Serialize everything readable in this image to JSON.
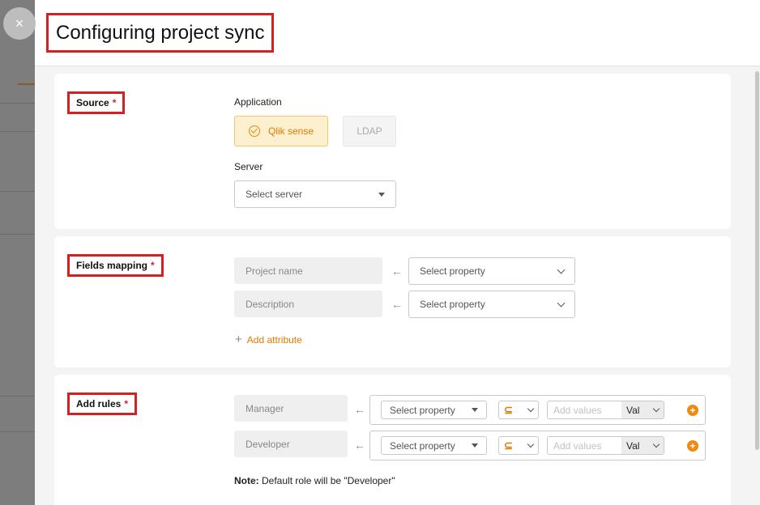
{
  "drawer": {
    "title": "Configuring project sync",
    "close_icon": "×"
  },
  "source": {
    "title": "Source",
    "required_mark": "*",
    "application_label": "Application",
    "applications": [
      {
        "label": "Qlik sense",
        "selected": true
      },
      {
        "label": "LDAP",
        "selected": false
      }
    ],
    "server_label": "Server",
    "server_placeholder": "Select server"
  },
  "fields_mapping": {
    "title": "Fields mapping",
    "required_mark": "*",
    "rows": [
      {
        "field": "Project name",
        "property_placeholder": "Select property"
      },
      {
        "field": "Description",
        "property_placeholder": "Select property"
      }
    ],
    "add_attribute": "Add attribute"
  },
  "rules": {
    "title": "Add rules",
    "required_mark": "*",
    "rows": [
      {
        "role": "Manager",
        "property_placeholder": "Select property",
        "values_placeholder": "Add values",
        "value_type": "Val"
      },
      {
        "role": "Developer",
        "property_placeholder": "Select property",
        "values_placeholder": "Add values",
        "value_type": "Val"
      }
    ],
    "note_label": "Note:",
    "note_text": " Default role will be \"Developer\""
  },
  "colors": {
    "accent": "#e07a00",
    "highlight": "#d42020",
    "selected_bg": "#fdf0cf"
  }
}
